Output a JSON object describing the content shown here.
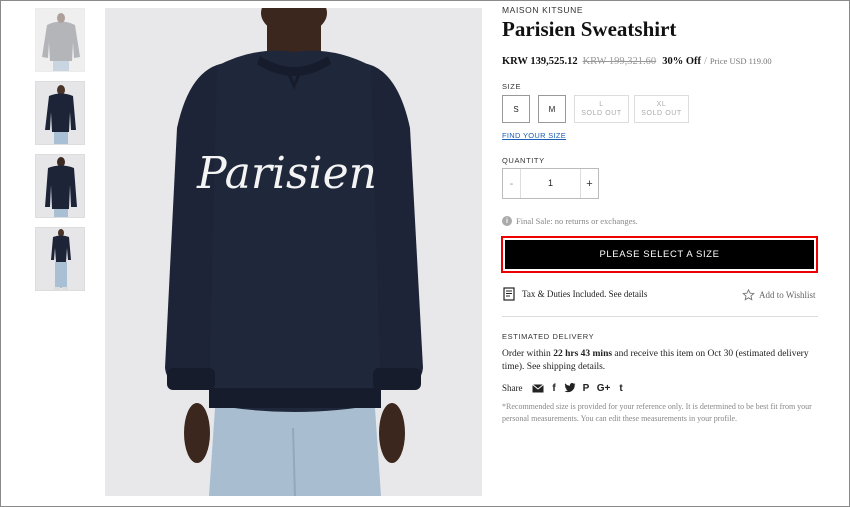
{
  "product": {
    "brand": "MAISON KITSUNE",
    "title": "Parisien Sweatshirt",
    "price": "KRW 139,525.12",
    "old_price": "KRW 199,321.60",
    "discount": "30% Off",
    "separator": "/",
    "usd_price": "Price USD 119.00",
    "print_text": "Parisien"
  },
  "size": {
    "label": "SIZE",
    "options": [
      {
        "label": "S",
        "status": ""
      },
      {
        "label": "M",
        "status": ""
      },
      {
        "label": "L",
        "status": "SOLD OUT"
      },
      {
        "label": "XL",
        "status": "SOLD OUT"
      }
    ],
    "find_link": "FIND YOUR SIZE"
  },
  "quantity": {
    "label": "QUANTITY",
    "minus": "-",
    "value": "1",
    "plus": "+"
  },
  "final_sale": {
    "icon_text": "i",
    "text": "Final Sale: no returns or exchanges."
  },
  "cta": {
    "label": "PLEASE SELECT A SIZE"
  },
  "tax": {
    "text": "Tax & Duties Included. See details"
  },
  "wishlist": {
    "label": "Add to Wishlist"
  },
  "delivery": {
    "label": "ESTIMATED DELIVERY",
    "prefix": "Order within ",
    "time": "22 hrs 43 mins",
    "suffix": " and receive this item on Oct 30 (estimated delivery time). See shipping details."
  },
  "share": {
    "label": "Share",
    "icons": [
      "email-icon",
      "facebook-icon",
      "twitter-icon",
      "pinterest-icon",
      "google-plus-icon",
      "tumblr-icon"
    ],
    "glyphs": {
      "facebook": "f",
      "pinterest": "P",
      "googleplus": "G+",
      "tumblr": "t"
    }
  },
  "note": "*Recommended size is provided for your reference only. It is determined to be best fit from your personal measurements. You can edit these measurements in your profile.",
  "colors": {
    "sweatshirt": "#1d2437",
    "background": "#e8e8ea",
    "cta": "#000000",
    "highlight": "#ee0000",
    "link": "#1a5fb4"
  }
}
